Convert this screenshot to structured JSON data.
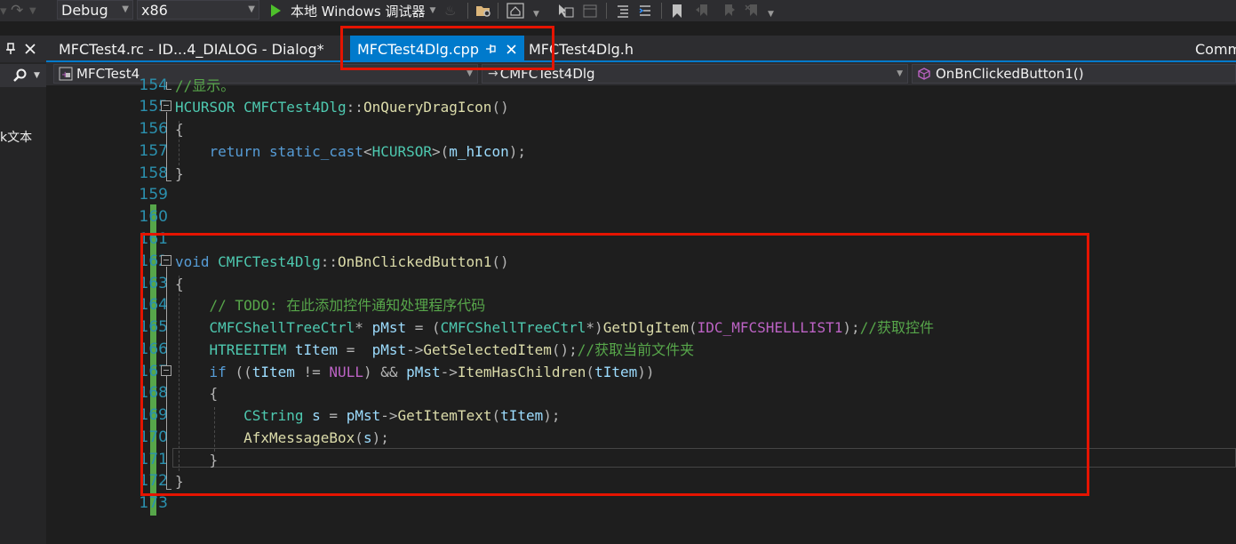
{
  "toolbar": {
    "config_value": "Debug",
    "platform_value": "x86",
    "debugger_label": "本地 Windows 调试器"
  },
  "left_panel": {
    "partial_text": "k文本"
  },
  "tabs": [
    {
      "label": "MFCTest4.rc - ID...4_DIALOG - Dialog*",
      "active": false
    },
    {
      "label": "MFCTest4Dlg.cpp",
      "active": true
    },
    {
      "label": "MFCTest4Dlg.h",
      "active": false
    },
    {
      "label": "Comm",
      "active": false
    }
  ],
  "navbar": {
    "project": "MFCTest4",
    "class_scope": "CMFCTest4Dlg",
    "member": "OnBnClickedButton1()"
  },
  "editor": {
    "line_numbers": [
      "154",
      "155",
      "156",
      "157",
      "158",
      "159",
      "160",
      "161",
      "162",
      "163",
      "164",
      "165",
      "166",
      "167",
      "168",
      "169",
      "170",
      "171",
      "172",
      "173"
    ],
    "lines": {
      "l154_comment": "//显示。",
      "l155_type": "HCURSOR",
      "l155_class": "CMFCTest4Dlg",
      "l155_op": "::",
      "l155_func": "OnQueryDragIcon",
      "l155_parens": "()",
      "l156": "{",
      "l157_kw1": "return",
      "l157_kw2": "static_cast",
      "l157_type": "HCURSOR",
      "l157_var": "m_hIcon",
      "l158": "}",
      "l162_kw": "void",
      "l162_class": "CMFCTest4Dlg",
      "l162_op": "::",
      "l162_func": "OnBnClickedButton1",
      "l162_parens": "()",
      "l163": "{",
      "l164_comment": "// TODO: 在此添加控件通知处理程序代码",
      "l165_type": "CMFCShellTreeCtrl",
      "l165_var": "pMst",
      "l165_cast_type": "CMFCShellTreeCtrl",
      "l165_func": "GetDlgItem",
      "l165_macro": "IDC_MFCSHELLLIST1",
      "l165_comment": "//获取控件",
      "l166_type": "HTREEITEM",
      "l166_var": "tItem",
      "l166_var2": "pMst",
      "l166_func": "GetSelectedItem",
      "l166_comment": "//获取当前文件夹",
      "l167_kw": "if",
      "l167_var": "tItem",
      "l167_macro": "NULL",
      "l167_var2": "pMst",
      "l167_func": "ItemHasChildren",
      "l167_var3": "tItem",
      "l168": "{",
      "l169_type": "CString",
      "l169_var": "s",
      "l169_var2": "pMst",
      "l169_func": "GetItemText",
      "l169_var3": "tItem",
      "l170_func": "AfxMessageBox",
      "l170_var": "s",
      "l171": "}",
      "l172": "}"
    }
  },
  "colors": {
    "accent_blue": "#007acc",
    "highlight_red": "#e51400",
    "change_green": "#57a64a"
  }
}
